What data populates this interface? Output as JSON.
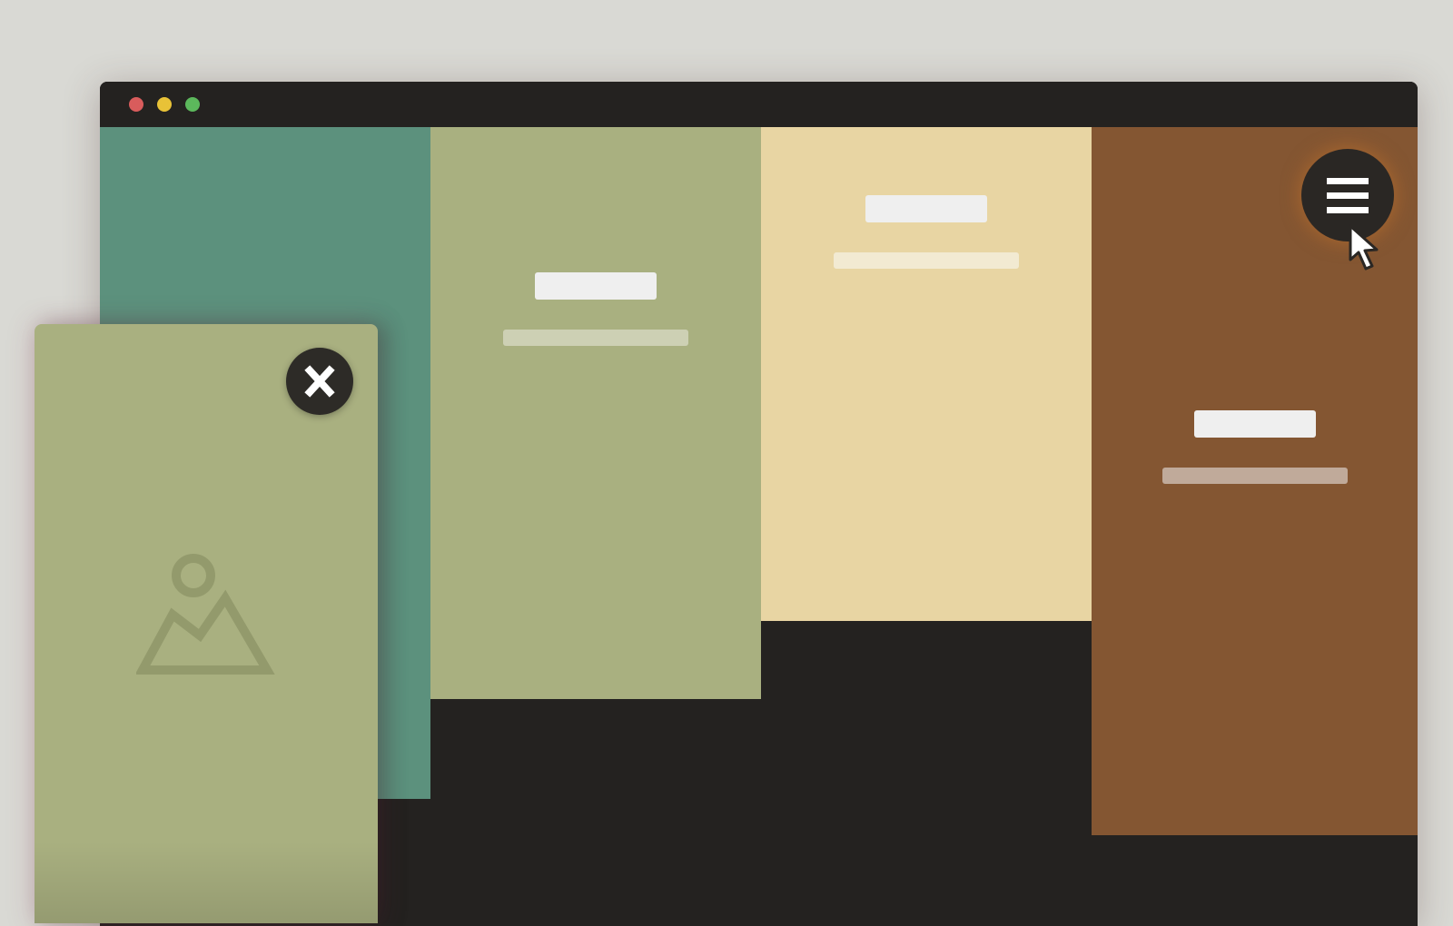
{
  "colors": {
    "page_background": "#d9d9d4",
    "window_chrome": "#242220",
    "dot_red": "#d95c5c",
    "dot_yellow": "#e8c237",
    "dot_green": "#5cb85c",
    "panel_teal": "#5c917d",
    "panel_olive": "#a9b080",
    "panel_sand": "#e8d5a3",
    "panel_brown": "#845632",
    "card_olive": "#a9b080",
    "button_dark": "#2a2724"
  },
  "window": {
    "controls": [
      "close",
      "minimize",
      "zoom"
    ]
  },
  "panels": [
    {
      "name": "teal",
      "color": "#5c917d"
    },
    {
      "name": "olive",
      "color": "#a9b080",
      "subtitle_color": "#cdd0b4"
    },
    {
      "name": "sand",
      "color": "#e8d5a3",
      "subtitle_color": "#f2ead2"
    },
    {
      "name": "brown",
      "color": "#845632",
      "subtitle_color": "#c0aa9a"
    }
  ],
  "icons": {
    "menu": "hamburger-menu-icon",
    "close": "close-x-icon",
    "image_placeholder": "image-placeholder-icon",
    "cursor": "mouse-pointer-cursor"
  }
}
